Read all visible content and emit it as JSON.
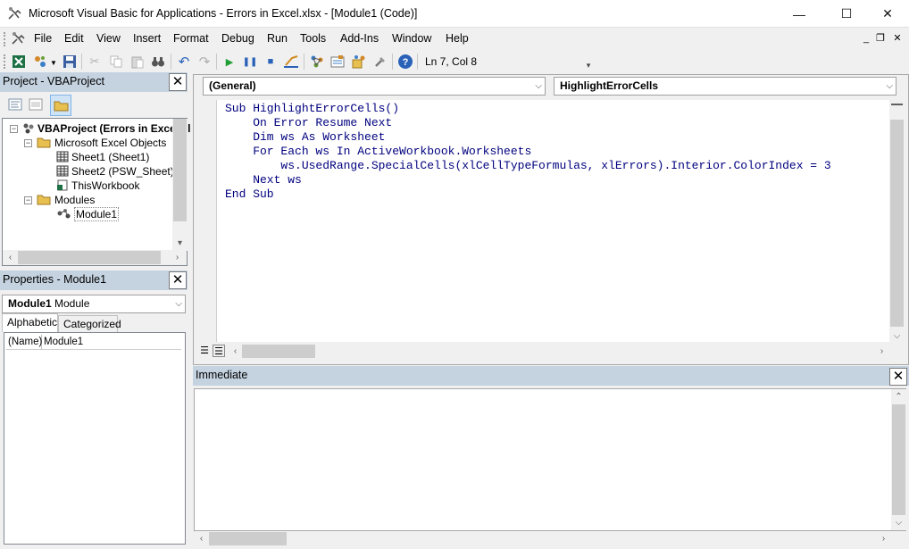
{
  "window": {
    "title": "Microsoft Visual Basic for Applications - Errors in Excel.xlsx - [Module1 (Code)]",
    "minimize_glyph": "—",
    "maximize_glyph": "☐",
    "close_glyph": "✕"
  },
  "menu": [
    "File",
    "Edit",
    "View",
    "Insert",
    "Format",
    "Debug",
    "Run",
    "Tools",
    "Add-Ins",
    "Window",
    "Help"
  ],
  "mdi_controls": {
    "minimize": "_",
    "restore": "❐",
    "close": "✕"
  },
  "toolbar": {
    "status": "Ln 7, Col 8",
    "icons": [
      "excel-icon",
      "insert-module-icon",
      "save-icon",
      "cut-icon",
      "copy-icon",
      "paste-icon",
      "find-icon",
      "undo-icon",
      "redo-icon",
      "run-icon",
      "break-icon",
      "reset-icon",
      "design-mode-icon",
      "project-explorer-icon",
      "properties-icon",
      "object-browser-icon",
      "toolbox-icon",
      "help-icon"
    ]
  },
  "project_pane": {
    "title": "Project - VBAProject",
    "tree": {
      "root": "VBAProject (Errors in Excel.xl",
      "objects_folder": "Microsoft Excel Objects",
      "sheet1": "Sheet1 (Sheet1)",
      "sheet2": "Sheet2 (PSW_Sheet)",
      "workbook": "ThisWorkbook",
      "modules_folder": "Modules",
      "module1": "Module1"
    }
  },
  "properties_pane": {
    "title": "Properties - Module1",
    "object_name": "Module1",
    "object_type": "Module",
    "tabs": [
      "Alphabetic",
      "Categorized"
    ],
    "rows": [
      {
        "name": "(Name)",
        "value": "Module1"
      }
    ]
  },
  "code_window": {
    "object_combo": "(General)",
    "procedure_combo": "HighlightErrorCells",
    "lines": [
      "Sub HighlightErrorCells()",
      "    On Error Resume Next",
      "    Dim ws As Worksheet",
      "    For Each ws In ActiveWorkbook.Worksheets",
      "        ws.UsedRange.SpecialCells(xlCellTypeFormulas, xlErrors).Interior.ColorIndex = 3",
      "    Next ws",
      "End Sub"
    ]
  },
  "immediate_pane": {
    "title": "Immediate"
  },
  "colors": {
    "pane_header": "#c5d3e0",
    "code_keyword": "#00007f",
    "selected_toolbar_button": "#cfe3f7"
  }
}
